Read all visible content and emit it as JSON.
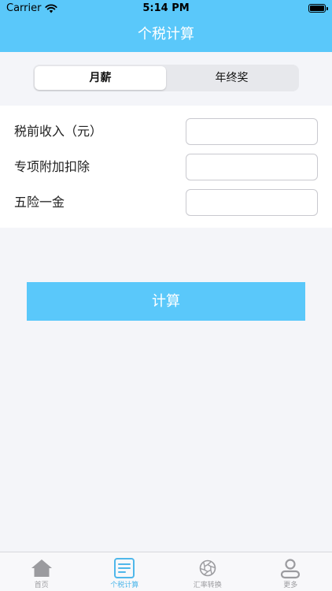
{
  "status_bar": {
    "carrier": "Carrier",
    "time": "5:14 PM"
  },
  "nav": {
    "title": "个税计算"
  },
  "segments": [
    {
      "label": "月薪",
      "selected": true
    },
    {
      "label": "年终奖",
      "selected": false
    }
  ],
  "form": {
    "fields": [
      {
        "label": "税前收入（元）",
        "value": ""
      },
      {
        "label": "专项附加扣除",
        "value": ""
      },
      {
        "label": "五险一金",
        "value": ""
      }
    ]
  },
  "actions": {
    "calculate_label": "计算"
  },
  "tab_bar": {
    "items": [
      {
        "label": "首页",
        "icon": "home-icon",
        "active": false
      },
      {
        "label": "个税计算",
        "icon": "document-icon",
        "active": true
      },
      {
        "label": "汇率转换",
        "icon": "aperture-icon",
        "active": false
      },
      {
        "label": "更多",
        "icon": "person-icon",
        "active": false
      }
    ]
  },
  "colors": {
    "accent": "#5ac8fa",
    "active_tab": "#4fb7ea",
    "inactive_tab": "#9b9b9f",
    "background": "#f4f5f9"
  }
}
